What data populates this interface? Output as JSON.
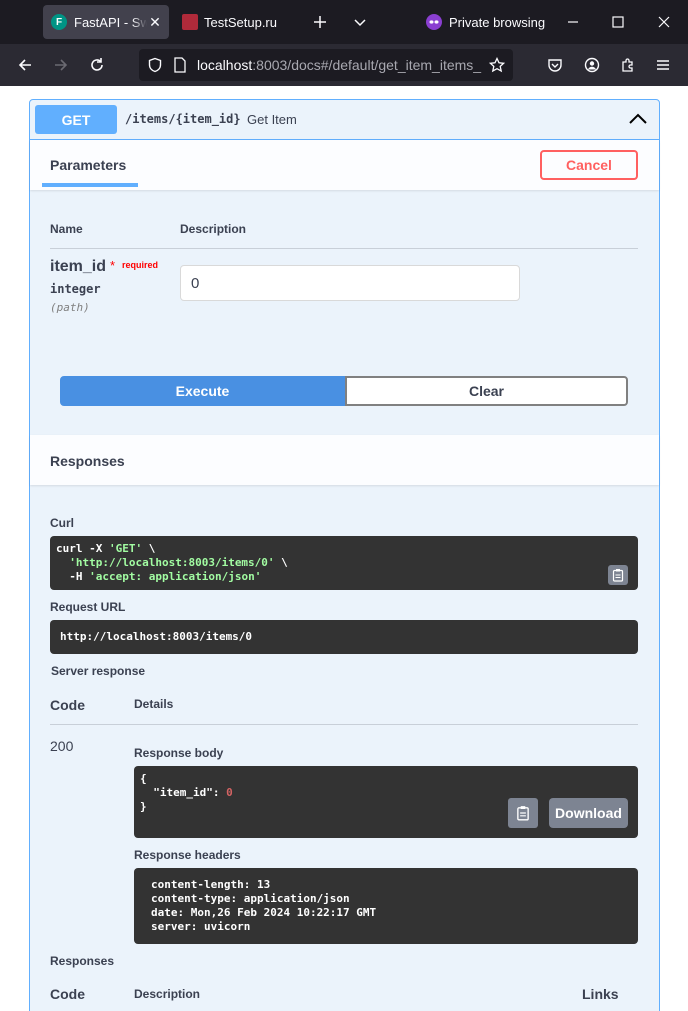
{
  "browser": {
    "tabs": [
      {
        "label": "FastAPI - Swagger UI",
        "favicon": "F",
        "active": true
      },
      {
        "label": "TestSetup.ru",
        "active": false
      }
    ],
    "private_label": "Private browsing",
    "url": {
      "host": "localhost",
      "rest": ":8003/docs#/default/get_item_items_"
    }
  },
  "operation": {
    "method": "GET",
    "path": "/items/{item_id}",
    "summary": "Get Item"
  },
  "parameters": {
    "title": "Parameters",
    "cancel_label": "Cancel",
    "col_name": "Name",
    "col_description": "Description",
    "param": {
      "name": "item_id",
      "required_star": "*",
      "required_label": "required",
      "type": "integer",
      "in": "(path)",
      "value": "0"
    },
    "execute_label": "Execute",
    "clear_label": "Clear"
  },
  "responses_section": {
    "title": "Responses",
    "curl_label": "Curl",
    "curl": {
      "line1_cmd": "curl -X ",
      "line1_method": "'GET'",
      "line1_tail": " \\",
      "line2_url": "'http://localhost:8003/items/0'",
      "line2_tail": " \\",
      "line3_flag": "  -H ",
      "line3_header": "'accept: application/json'"
    },
    "request_url_label": "Request URL",
    "request_url": "http://localhost:8003/items/0",
    "server_response_label": "Server response",
    "col_code": "Code",
    "col_details": "Details",
    "status_code": "200",
    "response_body_label": "Response body",
    "response_body": {
      "open": "{",
      "key": "\"item_id\"",
      "colon": ": ",
      "value": "0",
      "close": "}"
    },
    "download_label": "Download",
    "response_headers_label": "Response headers",
    "response_headers": [
      "content-length: 13",
      "content-type: application/json",
      "date: Mon,26 Feb 2024 10:22:17 GMT",
      "server: uvicorn"
    ],
    "responses_label": "Responses",
    "col_code2": "Code",
    "col_description2": "Description",
    "col_links": "Links"
  },
  "colors": {
    "get_method": "#61affe",
    "cancel": "#ff6060",
    "execute": "#4990e2"
  }
}
